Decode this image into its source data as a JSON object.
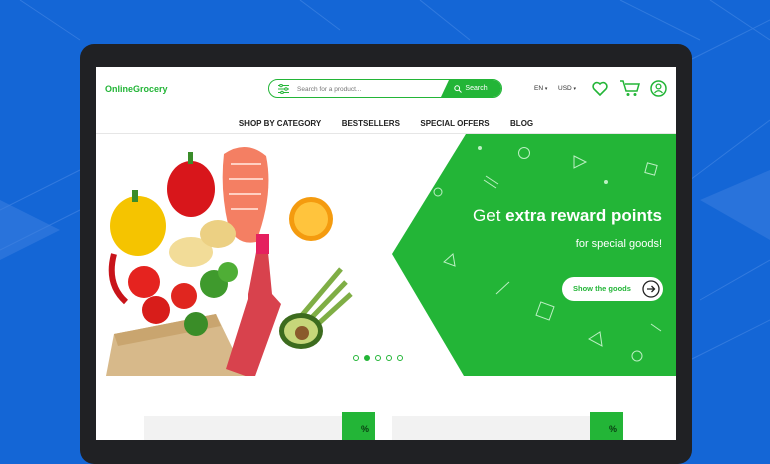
{
  "header": {
    "logo": "OnlineGrocery",
    "search_placeholder": "Search for a product...",
    "search_button": "Search",
    "language": "EN",
    "currency": "USD"
  },
  "nav": [
    "SHOP BY CATEGORY",
    "BESTSELLERS",
    "SPECIAL OFFERS",
    "BLOG"
  ],
  "hero": {
    "headline_prefix": "Get ",
    "headline_bold": "extra reward points",
    "subline": "for special goods!",
    "cta": "Show the goods",
    "slide_count": 5,
    "active_slide": 2
  },
  "promo_badge": "%",
  "colors": {
    "brand_green": "#23b537",
    "background_blue": "#1466d6"
  }
}
